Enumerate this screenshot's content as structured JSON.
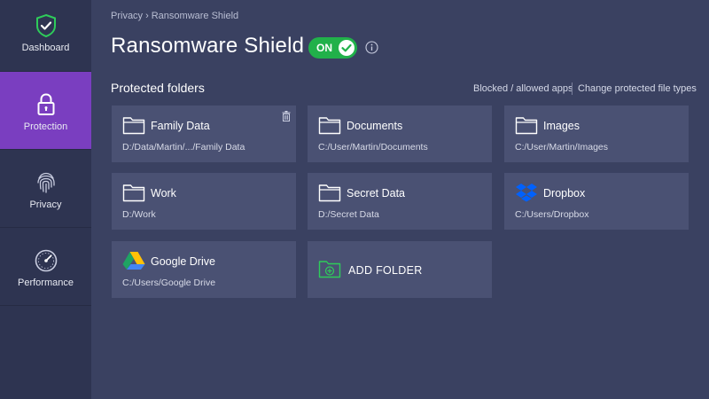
{
  "sidebar": {
    "items": [
      {
        "label": "Dashboard",
        "icon": "shield-check-icon"
      },
      {
        "label": "Protection",
        "icon": "lock-icon"
      },
      {
        "label": "Privacy",
        "icon": "fingerprint-icon"
      },
      {
        "label": "Performance",
        "icon": "speedometer-icon"
      }
    ],
    "active": "Protection"
  },
  "header": {
    "breadcrumb": [
      "Privacy",
      "Ransomware Shield"
    ],
    "breadcrumb_separator": "›",
    "title": "Ransomware Shield",
    "toggle_label": "ON"
  },
  "section": {
    "title": "Protected folders",
    "link_blocked": "Blocked / allowed apps",
    "link_change": "Change protected file types"
  },
  "folders": [
    {
      "name": "Family Data",
      "path": "D:/Data/Martin/.../Family Data",
      "icon": "folder-icon"
    },
    {
      "name": "Documents",
      "path": "C:/User/Martin/Documents",
      "icon": "folder-icon"
    },
    {
      "name": "Images",
      "path": "C:/User/Martin/Images",
      "icon": "folder-icon"
    },
    {
      "name": "Work",
      "path": "D:/Work",
      "icon": "folder-icon"
    },
    {
      "name": "Secret Data",
      "path": "D:/Secret Data",
      "icon": "folder-icon"
    },
    {
      "name": "Dropbox",
      "path": "C:/Users/Dropbox",
      "icon": "dropbox-icon"
    },
    {
      "name": "Google Drive",
      "path": "C:/Users/Google Drive",
      "icon": "google-drive-icon"
    }
  ],
  "add_folder_label": "ADD FOLDER",
  "colors": {
    "background": "#3a4161",
    "sidebar": "#2e3451",
    "active": "#7a3ec0",
    "card": "#4a5173",
    "accent_green": "#21b14a",
    "dropbox_blue": "#0061fe"
  }
}
